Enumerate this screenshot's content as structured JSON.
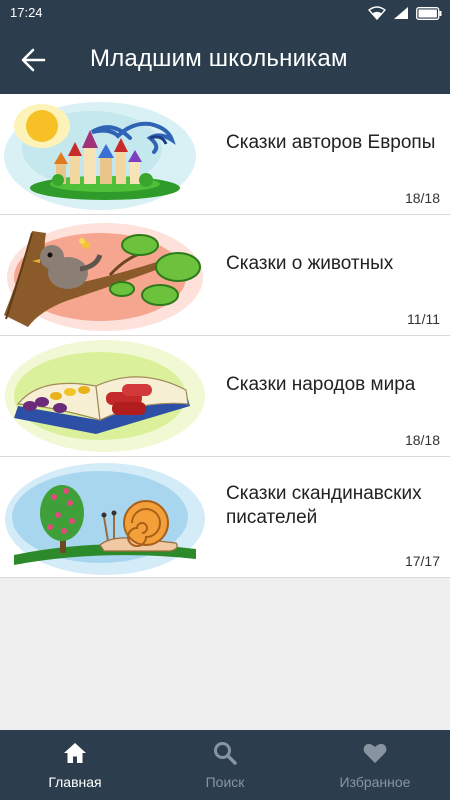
{
  "status_bar": {
    "time": "17:24"
  },
  "app_bar": {
    "title": "Младшим школьникам",
    "back_icon": "arrow-left-icon"
  },
  "items": [
    {
      "title": "Сказки авторов Европы",
      "count": "18/18",
      "image": "castle-bird-illustration"
    },
    {
      "title": "Сказки о животных",
      "count": "11/11",
      "image": "bird-on-branch-illustration"
    },
    {
      "title": "Сказки народов мира",
      "count": "18/18",
      "image": "open-book-illustration"
    },
    {
      "title": "Сказки скандинавских писателей",
      "count": "17/17",
      "image": "snail-bush-illustration"
    }
  ],
  "bottom_nav": [
    {
      "label": "Главная",
      "icon": "home-icon",
      "active": true
    },
    {
      "label": "Поиск",
      "icon": "search-icon",
      "active": false
    },
    {
      "label": "Избранное",
      "icon": "heart-icon",
      "active": false
    }
  ],
  "colors": {
    "bar": "#2c3e4d",
    "background": "#efefef",
    "inactive_tab": "#8895a0"
  }
}
